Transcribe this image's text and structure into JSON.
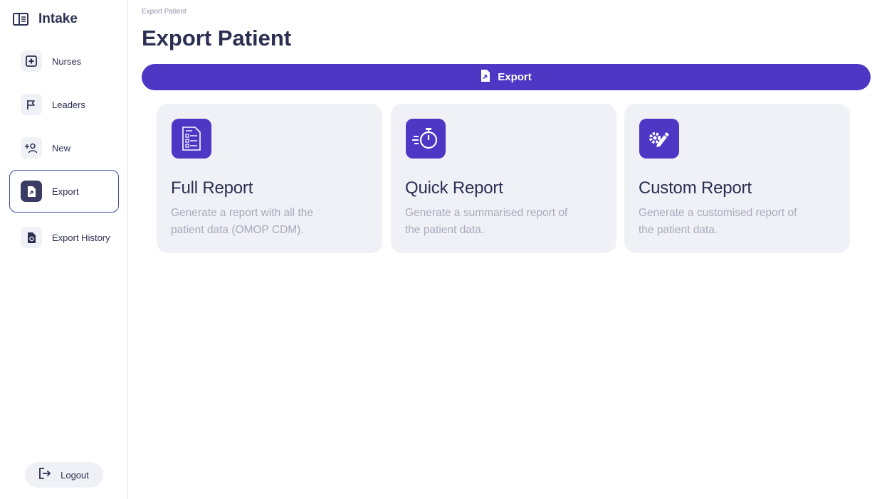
{
  "app": {
    "title": "Intake"
  },
  "sidebar": {
    "items": [
      {
        "label": "Nurses",
        "icon": "plus-box-icon"
      },
      {
        "label": "Leaders",
        "icon": "flag-icon"
      },
      {
        "label": "New",
        "icon": "add-user-icon"
      },
      {
        "label": "Export",
        "icon": "file-export-icon",
        "active": true
      },
      {
        "label": "Export History",
        "icon": "file-history-icon"
      }
    ],
    "logout_label": "Logout"
  },
  "breadcrumb": "Export Patient",
  "page_title": "Export Patient",
  "export_bar": {
    "label": "Export",
    "icon": "file-export-icon"
  },
  "cards": [
    {
      "title": "Full Report",
      "description": "Generate a report with all the patient data (OMOP CDM).",
      "icon": "checklist-document-icon"
    },
    {
      "title": "Quick Report",
      "description": "Generate a summarised report of the patient data.",
      "icon": "stopwatch-icon"
    },
    {
      "title": "Custom Report",
      "description": "Generate a customised report of the patient data.",
      "icon": "gear-pencil-icon"
    }
  ],
  "colors": {
    "accent": "#4f37c6",
    "text": "#2b2f52",
    "muted": "#a7a9bd",
    "card_bg": "#f0f1f6",
    "active_border": "#3b4ba0"
  }
}
